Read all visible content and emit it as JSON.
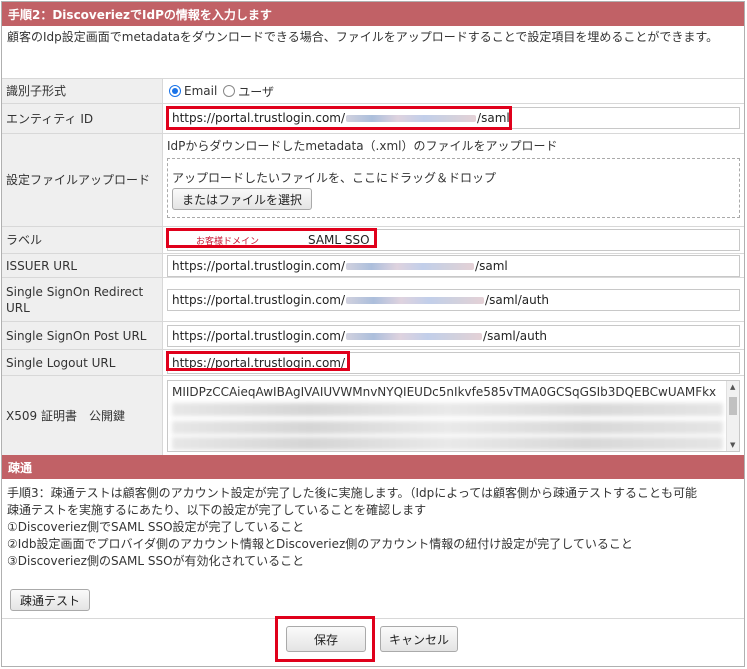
{
  "step2": {
    "title": "手順2：DiscoveriezでIdPの情報を入力します",
    "description": "顧客のIdp設定画面でmetadataをダウンロードできる場合、ファイルをアップロードすることで設定項目を埋めることができます。"
  },
  "form": {
    "id_format": {
      "label": "識別子形式",
      "options": [
        "Email",
        "ユーザ"
      ],
      "selected": "Email"
    },
    "entity_id": {
      "label": "エンティティ ID",
      "value_prefix": "https://portal.trustlogin.com/",
      "value_suffix": "/saml"
    },
    "upload": {
      "label": "設定ファイルアップロード",
      "hint": "IdPからダウンロードしたmetadata（.xml）のファイルをアップロード",
      "drop_text": "アップロードしたいファイルを、ここにドラッグ＆ドロップ",
      "button": "またはファイルを選択"
    },
    "label_field": {
      "label": "ラベル",
      "note": "お客様ドメイン",
      "value": "SAML SSO"
    },
    "issuer_url": {
      "label": "ISSUER URL",
      "value_prefix": "https://portal.trustlogin.com/",
      "value_suffix": "/saml"
    },
    "sso_redirect_url": {
      "label": "Single SignOn Redirect URL",
      "value_prefix": "https://portal.trustlogin.com/",
      "value_suffix": "/saml/auth"
    },
    "sso_post_url": {
      "label": "Single SignOn Post URL",
      "value_prefix": "https://portal.trustlogin.com/",
      "value_suffix": "/saml/auth"
    },
    "slo_url": {
      "label": "Single Logout URL",
      "value": "https://portal.trustlogin.com/"
    },
    "x509": {
      "label": "X509 証明書　公開鍵",
      "value": "MIIDPzCCAieqAwIBAgIVAIUVWMnvNYQIEUDc5nIkvfe585vTMA0GCSqGSIb3DQEBCwUAMFkx"
    }
  },
  "connectivity": {
    "title": "疎通",
    "lines": [
      "手順3：疎通テストは顧客側のアカウント設定が完了した後に実施します。（Idpによっては顧客側から疎通テストすることも可能",
      "疎通テストを実施するにあたり、以下の設定が完了していることを確認します",
      "①Discoveriez側でSAML SSO設定が完了していること",
      "②Idb設定画面でプロバイダ側のアカウント情報とDiscoveriez側のアカウント情報の紐付け設定が完了していること",
      "③Discoveriez側のSAML SSOが有効化されていること"
    ],
    "test_button": "疎通テスト"
  },
  "footer": {
    "save": "保存",
    "cancel": "キャンセル"
  },
  "colors": {
    "header_bg": "#c16166",
    "highlight": "#e0001b",
    "radio_accent": "#1a73e8"
  }
}
